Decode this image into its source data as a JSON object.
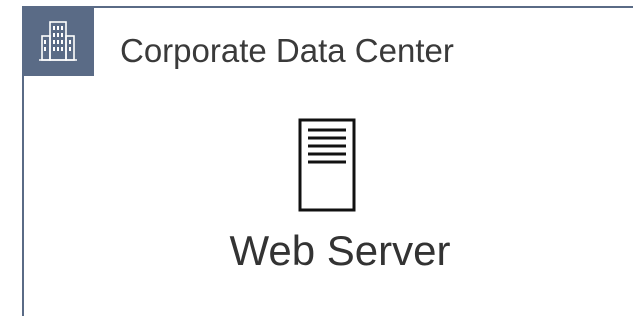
{
  "group": {
    "title": "Corporate Data Center",
    "icon": "building-icon",
    "color": "#5a6b86"
  },
  "node": {
    "label": "Web Server",
    "icon": "server-icon"
  }
}
